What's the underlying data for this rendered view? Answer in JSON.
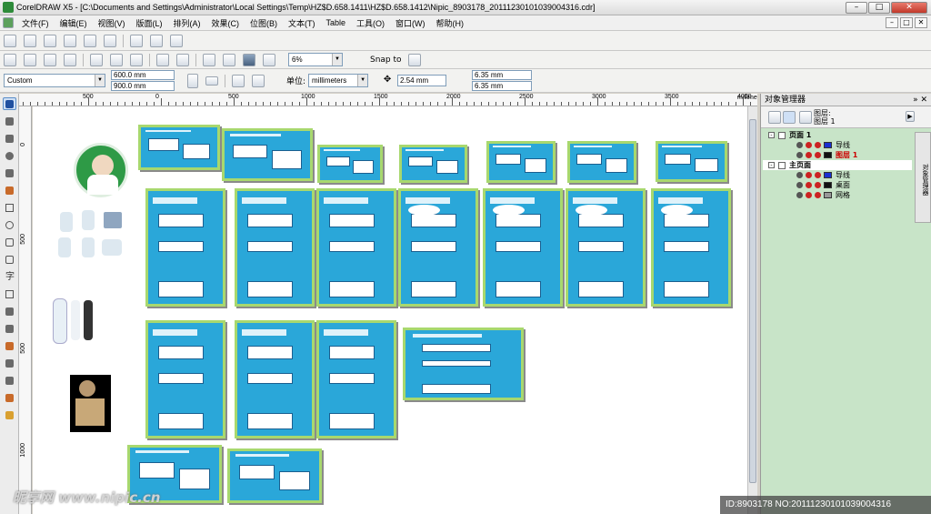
{
  "window": {
    "title": "CorelDRAW X5 - [C:\\Documents and Settings\\Administrator\\Local Settings\\Temp\\HZ$D.658.1411\\HZ$D.658.1412\\Nipic_8903178_20111230101039004316.cdr]",
    "min": "–",
    "max": "□",
    "close": "✕"
  },
  "menu": [
    "文件(F)",
    "编辑(E)",
    "视图(V)",
    "版面(L)",
    "排列(A)",
    "效果(C)",
    "位图(B)",
    "文本(T)",
    "Table",
    "工具(O)",
    "窗口(W)",
    "帮助(H)"
  ],
  "toolbar": {
    "zoom": "6%",
    "snap": "Snap to",
    "page_size": "Custom",
    "width": "600.0 mm",
    "height": "900.0 mm",
    "units_label": "单位:",
    "units": "millimeters",
    "nudge": "2.54 mm",
    "dup_x": "6.35 mm",
    "dup_y": "6.35 mm"
  },
  "ruler": {
    "unit": "millimeters",
    "h_labels": [
      "500",
      "0",
      "500",
      "1000",
      "1500",
      "2000",
      "2500",
      "3000",
      "3500",
      "4000",
      "4500"
    ],
    "v_labels": [
      "0",
      "500",
      "500",
      "1000"
    ]
  },
  "panel": {
    "title": "对象管理器",
    "layer_caption1": "图层:",
    "layer_caption2": "图层 1",
    "tab": "对象管理器",
    "rows": [
      {
        "label": "页面 1",
        "bold": true,
        "color": "#000"
      },
      {
        "label": "导线",
        "bold": false,
        "color": "#000"
      },
      {
        "label": "图层 1",
        "bold": true,
        "color": "#cc0000"
      },
      {
        "label": "主页面",
        "bold": true,
        "color": "#000"
      },
      {
        "label": "导线",
        "bold": false,
        "color": "#000"
      },
      {
        "label": "桌面",
        "bold": false,
        "color": "#000"
      },
      {
        "label": "网格",
        "bold": false,
        "color": "#000"
      }
    ]
  },
  "footer": {
    "watermark": "昵享网 www.nipic.cn",
    "id": "ID:8903178 NO:20111230101039004316"
  }
}
